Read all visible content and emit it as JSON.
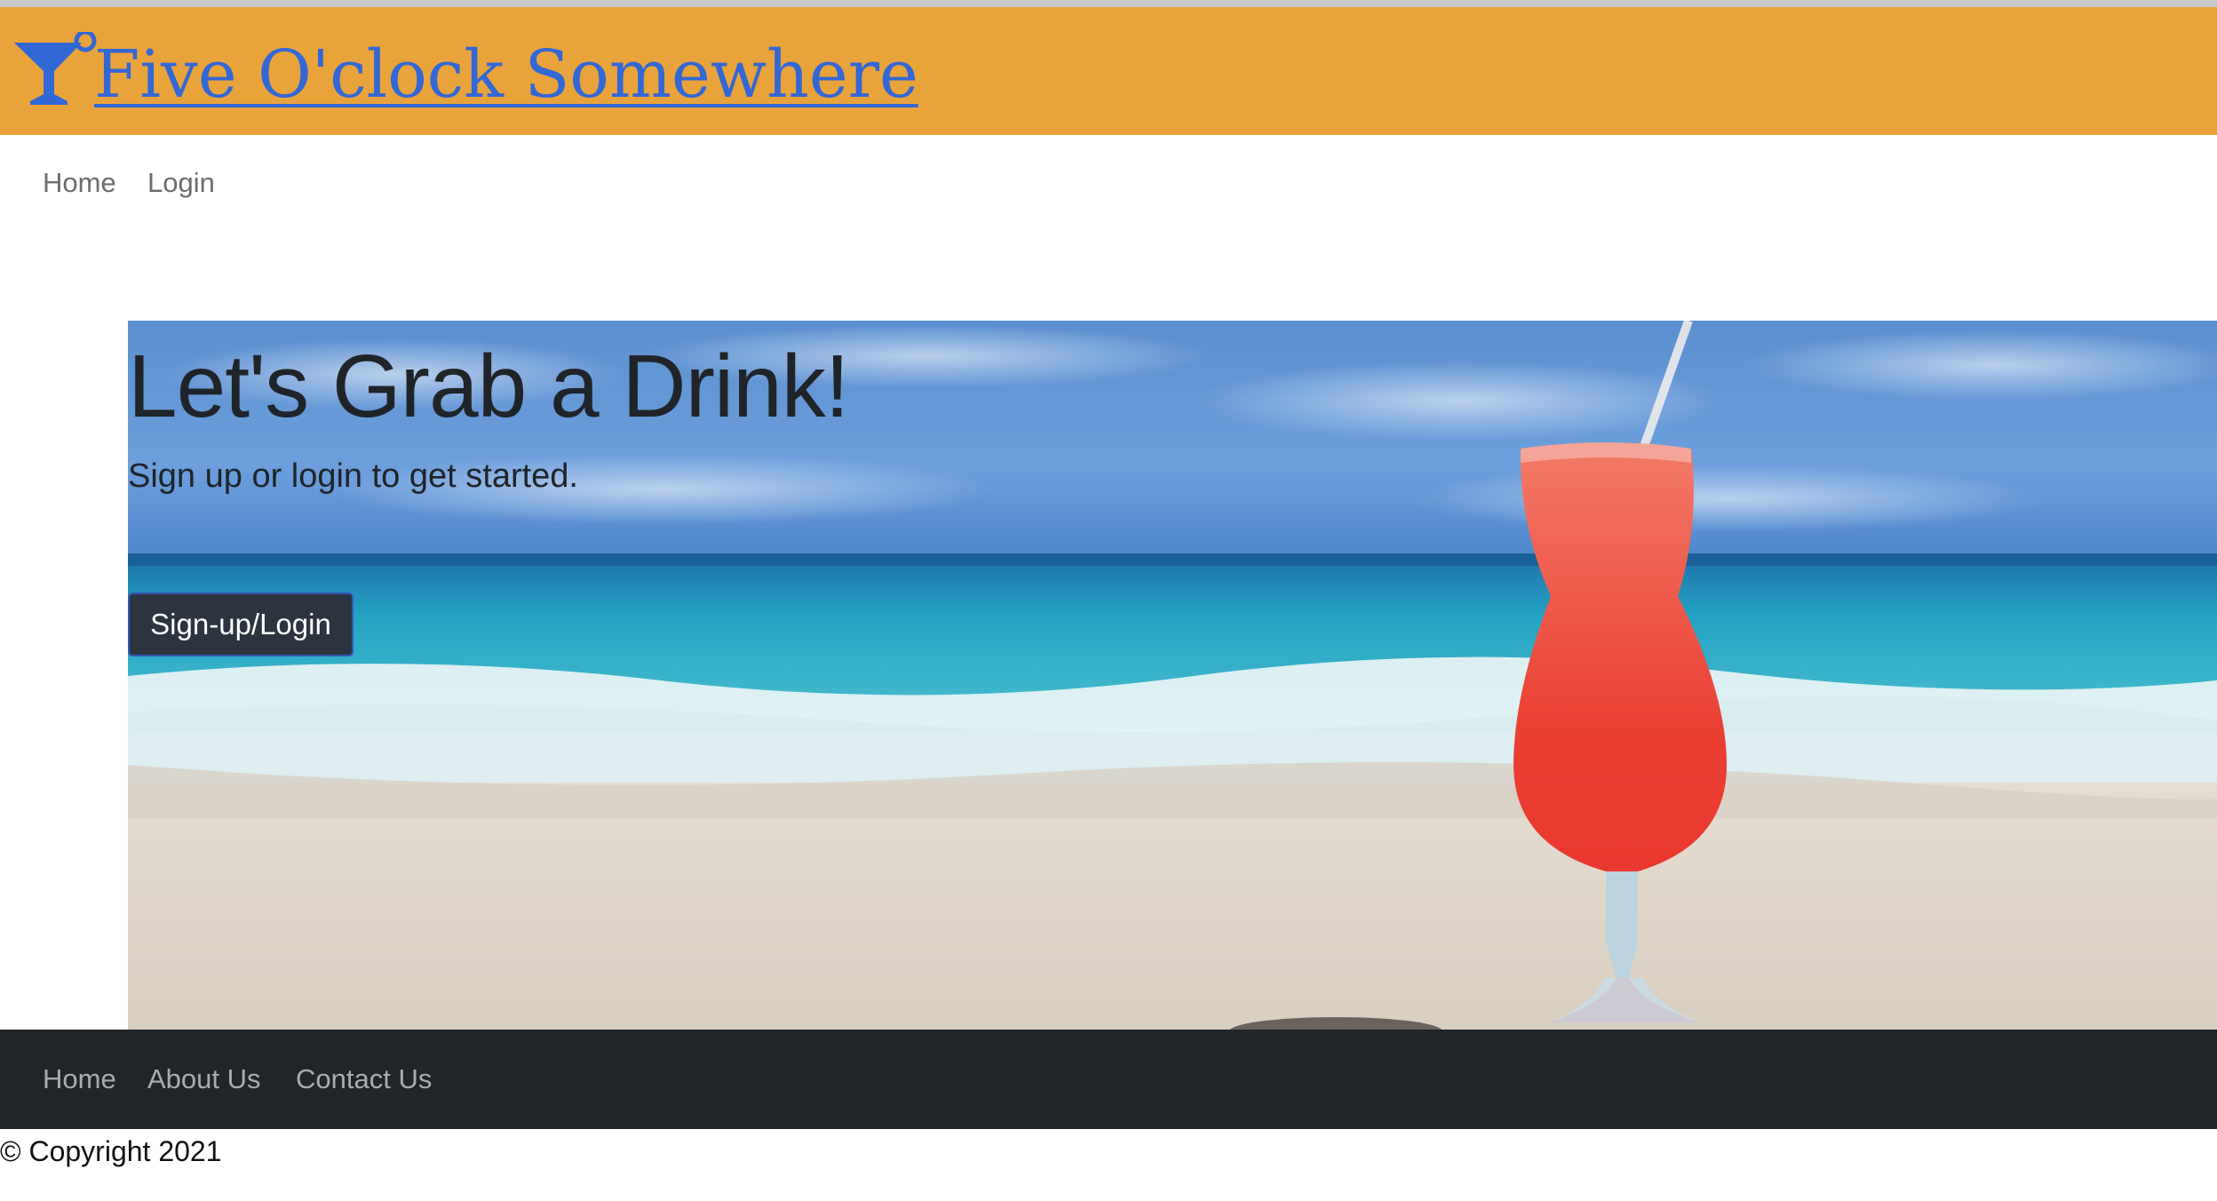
{
  "header": {
    "brand_title": "Five O'clock Somewhere",
    "logo_icon": "cocktail-glass-icon",
    "background_color": "#e9a33b",
    "brand_color": "#3267d6"
  },
  "top_nav": {
    "items": [
      {
        "label": "Home"
      },
      {
        "label": "Login"
      }
    ]
  },
  "hero": {
    "title": "Let's Grab a Drink!",
    "subtitle": "Sign up or login to get started.",
    "button_label": "Sign-up/Login",
    "image": "beach-cocktail-image"
  },
  "footer": {
    "items": [
      {
        "label": "Home"
      },
      {
        "label": "About Us"
      },
      {
        "label": "Contact Us"
      }
    ],
    "background_color": "#212529"
  },
  "copyright": "© Copyright 2021"
}
